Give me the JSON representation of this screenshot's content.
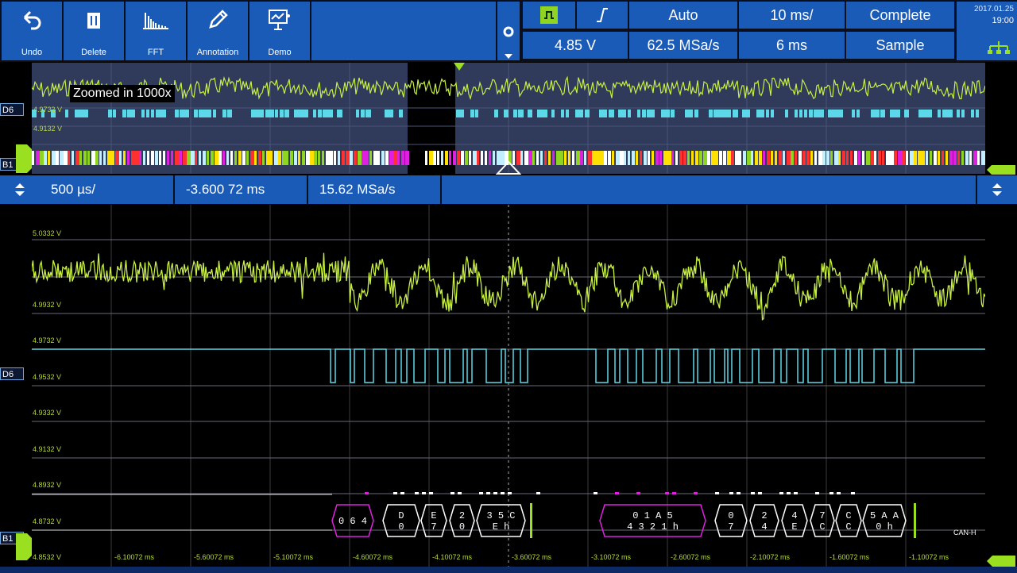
{
  "toolbar": {
    "undo_label": "Undo",
    "delete_label": "Delete",
    "fft_label": "FFT",
    "annotation_label": "Annotation",
    "demo_label": "Demo"
  },
  "settings": {
    "trigger_source_icon": "square-wave-icon",
    "trigger_edge_icon": "rising-edge-icon",
    "trigger_mode": "Auto",
    "timebase": "10 ms/",
    "acquisition": "Complete",
    "trigger_level": "4.85 V",
    "sample_rate": "62.5 MSa/s",
    "record_length": "6 ms",
    "acq_mode": "Sample"
  },
  "clock": {
    "date": "2017.01.25",
    "time": "19:00"
  },
  "overview": {
    "zoom_text": "Zoomed in 1000x",
    "ch_d6": "D6",
    "ch_b1": "B1",
    "ylabels": [
      "4.9732 V",
      "4.9132 V"
    ]
  },
  "zoom": {
    "time_per_div": "500 µs/",
    "position": "-3.600 72 ms",
    "sample_rate": "15.62 MSa/s"
  },
  "main": {
    "ylabels": [
      "5.0332 V",
      "4.9932 V",
      "4.9732 V",
      "4.9532 V",
      "4.9332 V",
      "4.9132 V",
      "4.8932 V",
      "4.8732 V",
      "4.8532 V"
    ],
    "xlabels": [
      "-6.10072 ms",
      "-5.60072 ms",
      "-5.10072 ms",
      "-4.60072 ms",
      "-4.10072 ms",
      "-3.60072 ms",
      "-3.10072 ms",
      "-2.60072 ms",
      "-2.10072 ms",
      "-1.60072 ms",
      "-1.10072 ms"
    ],
    "ch_d6": "D6",
    "ch_b1": "B1",
    "bus_label": "CAN-H",
    "decode": [
      {
        "top": "0 6 4",
        "bottom": ""
      },
      {
        "top": "D",
        "bottom": "0"
      },
      {
        "top": "E",
        "bottom": "7"
      },
      {
        "top": "2",
        "bottom": "0"
      },
      {
        "top": "3 5 C",
        "bottom": "E h"
      },
      {
        "top": "0 1 A 5",
        "bottom": "4 3 2 1 h"
      },
      {
        "top": "0",
        "bottom": "7"
      },
      {
        "top": "2",
        "bottom": "4"
      },
      {
        "top": "4",
        "bottom": "E"
      },
      {
        "top": "7",
        "bottom": "C"
      },
      {
        "top": "C",
        "bottom": "C"
      },
      {
        "top": "5 A A",
        "bottom": "0 h"
      }
    ]
  },
  "colors": {
    "analog": "#c8f040",
    "digital": "#5cd8e8",
    "accent": "#1b5bb8",
    "decode_header": "#e020e0"
  }
}
